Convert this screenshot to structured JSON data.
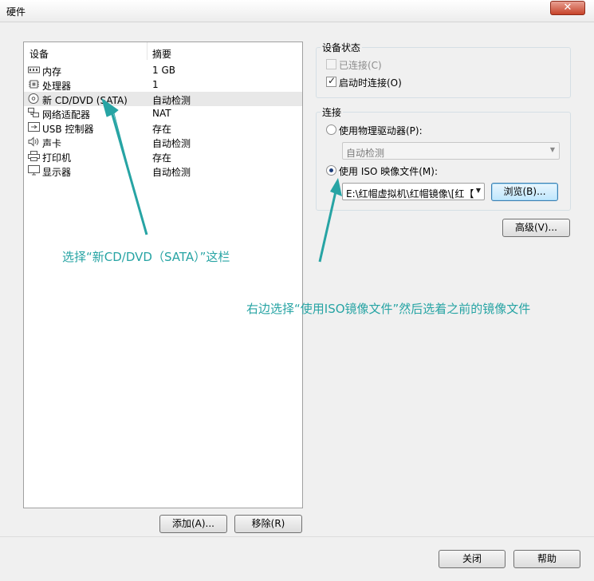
{
  "window": {
    "title": "硬件",
    "close_symbol": "✕"
  },
  "device_list": {
    "col_device": "设备",
    "col_summary": "摘要",
    "rows": [
      {
        "name": "内存",
        "summary": "1 GB",
        "icon": "memory-icon"
      },
      {
        "name": "处理器",
        "summary": "1",
        "icon": "processor-icon"
      },
      {
        "name": "新 CD/DVD (SATA)",
        "summary": "自动检测",
        "icon": "cd-dvd-icon",
        "selected": true
      },
      {
        "name": "网络适配器",
        "summary": "NAT",
        "icon": "network-adapter-icon"
      },
      {
        "name": "USB 控制器",
        "summary": "存在",
        "icon": "usb-controller-icon"
      },
      {
        "name": "声卡",
        "summary": "自动检测",
        "icon": "sound-card-icon"
      },
      {
        "name": "打印机",
        "summary": "存在",
        "icon": "printer-icon"
      },
      {
        "name": "显示器",
        "summary": "自动检测",
        "icon": "display-icon"
      }
    ],
    "add_label": "添加(A)...",
    "remove_label": "移除(R)"
  },
  "device_status": {
    "title": "设备状态",
    "connected_label": "已连接(C)",
    "connected_checked": false,
    "connected_enabled": false,
    "connect_on_start_label": "启动时连接(O)",
    "connect_on_start_checked": true
  },
  "connection": {
    "title": "连接",
    "physical_drive_label": "使用物理驱动器(P):",
    "physical_drive_value": "自动检测",
    "iso_label": "使用 ISO 映像文件(M):",
    "iso_value": "E:\\红帽虚拟机\\红帽镜像\\[红【",
    "iso_selected": true,
    "browse_label": "浏览(B)..."
  },
  "advanced_label": "高级(V)...",
  "footer": {
    "close_label": "关闭",
    "help_label": "帮助"
  },
  "annotations": {
    "left_note": "选择“新CD/DVD（SATA）”这栏",
    "right_note": "右边选择“使用ISO镜像文件”然后选着之前的镜像文件"
  },
  "colors": {
    "annotation": "#27a4a4",
    "selection": "#e8e8e8"
  }
}
